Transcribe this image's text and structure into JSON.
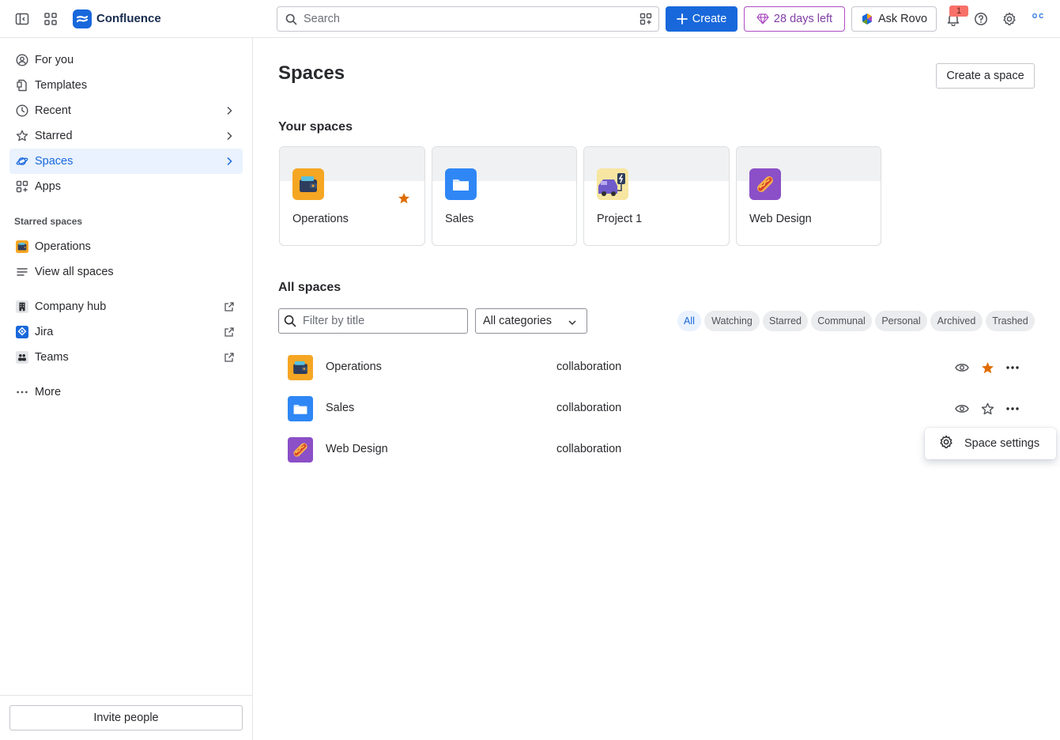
{
  "topbar": {
    "brand": "Confluence",
    "search_placeholder": "Search",
    "create_label": "Create",
    "trial_label": "28 days left",
    "rovo_label": "Ask Rovo",
    "notification_count": "1",
    "avatar_text": "O C",
    "accent": "#1868DB"
  },
  "sidebar": {
    "nav": [
      {
        "label": "For you",
        "icon": "person-circle-icon"
      },
      {
        "label": "Templates",
        "icon": "templates-icon"
      },
      {
        "label": "Recent",
        "icon": "clock-icon"
      },
      {
        "label": "Starred",
        "icon": "star-icon"
      },
      {
        "label": "Spaces",
        "icon": "planet-icon"
      },
      {
        "label": "Apps",
        "icon": "apps-icon"
      }
    ],
    "starred_spaces_label": "Starred spaces",
    "starred": [
      {
        "label": "Operations"
      },
      {
        "label": "View all spaces"
      }
    ],
    "external": [
      {
        "label": "Company hub"
      },
      {
        "label": "Jira"
      },
      {
        "label": "Teams"
      }
    ],
    "more_label": "More",
    "invite_label": "Invite people"
  },
  "main": {
    "title": "Spaces",
    "create_space_label": "Create a space",
    "your_spaces_label": "Your spaces",
    "your_spaces": [
      {
        "name": "Operations",
        "starred": true
      },
      {
        "name": "Sales",
        "starred": false
      },
      {
        "name": "Project 1",
        "starred": false
      },
      {
        "name": "Web Design",
        "starred": false
      }
    ],
    "all_spaces_label": "All spaces",
    "filter_placeholder": "Filter by title",
    "category_value": "All categories",
    "chips": [
      "All",
      "Watching",
      "Starred",
      "Communal",
      "Personal",
      "Archived",
      "Trashed"
    ],
    "rows": [
      {
        "name": "Operations",
        "category": "collaboration",
        "starred": true
      },
      {
        "name": "Sales",
        "category": "collaboration",
        "starred": false
      },
      {
        "name": "Web Design",
        "category": "collaboration",
        "starred": false
      }
    ],
    "popup_label": "Space settings"
  }
}
